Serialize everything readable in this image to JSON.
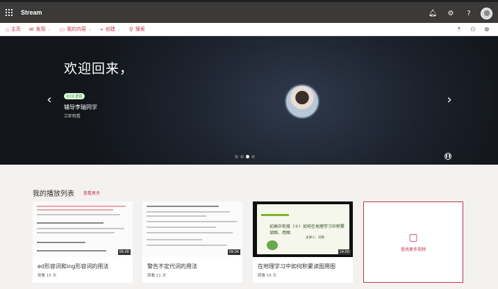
{
  "app": {
    "title": "Stream"
  },
  "nav": {
    "items": [
      {
        "label": "主页",
        "icon": "home-icon",
        "glyph": "⌂",
        "caret": ""
      },
      {
        "label": "发现",
        "icon": "chat-icon",
        "glyph": "✉",
        "caret": "⌄"
      },
      {
        "label": "我的内容",
        "icon": "folder-icon",
        "glyph": "▭",
        "caret": "⌄"
      },
      {
        "label": "创建",
        "icon": "plus-icon",
        "glyph": "+",
        "caret": "⌄"
      },
      {
        "label": "搜索",
        "icon": "search-icon",
        "glyph": "⚲",
        "caret": ""
      }
    ]
  },
  "hero": {
    "greeting": "欢迎回来，",
    "badge": "正在",
    "name": "辅导李瑞同学",
    "sub": "立即观看"
  },
  "playlist": {
    "title": "我的播放列表",
    "more": "查看更多",
    "cards": [
      {
        "title": "ed形容词和ing形容词的用法",
        "views": "观看 15 次",
        "duration": "06:06"
      },
      {
        "title": "警告不定代词的用法",
        "views": "观看 11 次",
        "duration": "09:04"
      },
      {
        "title": "在地理学习中如何积累读图用图",
        "views": "观看 16 次",
        "duration": "14:00"
      }
    ],
    "find_label": "查找更多视频"
  },
  "slide": {
    "heading": "初高中衔接（十）如何在地理学习中积累读图、用图",
    "sub": "主讲人：刘晓"
  }
}
